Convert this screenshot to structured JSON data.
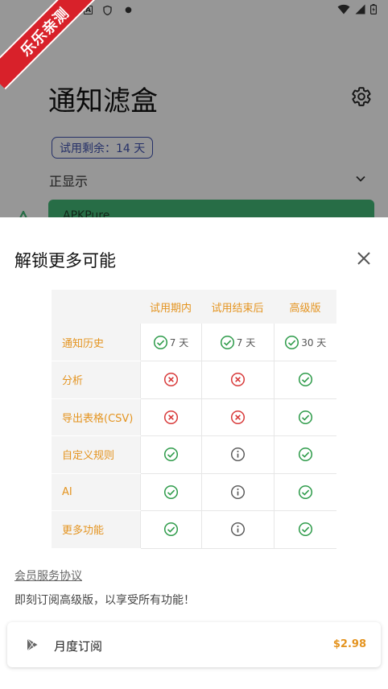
{
  "colors": {
    "accent": "#e49420",
    "check": "#2e9b4a",
    "cross": "#d83a3a",
    "info": "#555555",
    "brand_green": "#3fb071",
    "chip": "#3c4ea8"
  },
  "ribbon": {
    "text": "乐乐亲测"
  },
  "app": {
    "title": "通知滤盒",
    "trial_chip": "试用剩余：14 天",
    "filter_label": "正显示",
    "first_card": "APKPure"
  },
  "sheet": {
    "title": "解锁更多可能",
    "columns": [
      "试用期内",
      "试用结束后",
      "高级版"
    ],
    "rows": [
      {
        "feature": "通知历史",
        "cells": [
          {
            "icon": "check",
            "text": "7 天"
          },
          {
            "icon": "check",
            "text": "7 天"
          },
          {
            "icon": "check",
            "text": "30 天"
          }
        ]
      },
      {
        "feature": "分析",
        "cells": [
          {
            "icon": "cross",
            "text": ""
          },
          {
            "icon": "cross",
            "text": ""
          },
          {
            "icon": "check",
            "text": ""
          }
        ]
      },
      {
        "feature": "导出表格(CSV)",
        "cells": [
          {
            "icon": "cross",
            "text": ""
          },
          {
            "icon": "cross",
            "text": ""
          },
          {
            "icon": "check",
            "text": ""
          }
        ]
      },
      {
        "feature": "自定义规则",
        "cells": [
          {
            "icon": "check",
            "text": ""
          },
          {
            "icon": "info",
            "text": ""
          },
          {
            "icon": "check",
            "text": ""
          }
        ]
      },
      {
        "feature": "AI",
        "cells": [
          {
            "icon": "check",
            "text": ""
          },
          {
            "icon": "info",
            "text": ""
          },
          {
            "icon": "check",
            "text": ""
          }
        ]
      },
      {
        "feature": "更多功能",
        "cells": [
          {
            "icon": "check",
            "text": ""
          },
          {
            "icon": "info",
            "text": ""
          },
          {
            "icon": "check",
            "text": ""
          }
        ]
      }
    ],
    "agreement_link": "会员服务协议",
    "subscribe_hint": "即刻订阅高级版，以享受所有功能！",
    "plan": {
      "name": "月度订阅",
      "price": "$2.98",
      "icon": "play-store-icon"
    }
  }
}
